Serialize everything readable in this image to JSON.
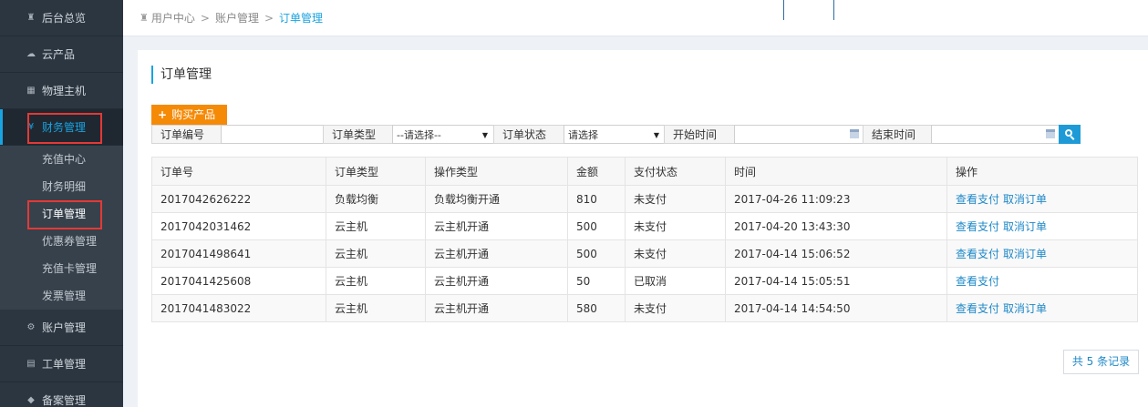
{
  "sidebar": {
    "items": [
      {
        "label": "后台总览",
        "icon": "home-icon"
      },
      {
        "label": "云产品",
        "icon": "cloud-icon"
      },
      {
        "label": "物理主机",
        "icon": "server-icon"
      },
      {
        "label": "财务管理",
        "icon": "finance-icon"
      },
      {
        "label": "账户管理",
        "icon": "users-icon"
      },
      {
        "label": "工单管理",
        "icon": "ticket-icon"
      },
      {
        "label": "备案管理",
        "icon": "shield-icon"
      }
    ],
    "finance_sub": [
      "充值中心",
      "财务明细",
      "订单管理",
      "优惠券管理",
      "充值卡管理",
      "发票管理"
    ],
    "active_color": "#19a3e0",
    "highlight_color": "#e53935"
  },
  "breadcrumb": {
    "items": [
      "用户中心",
      "账户管理",
      "订单管理"
    ],
    "separator": ">"
  },
  "page": {
    "title": "订单管理",
    "buy_button": "购买产品"
  },
  "filters": {
    "order_no_label": "订单编号",
    "order_type_label": "订单类型",
    "order_type_value": "--请选择--",
    "order_status_label": "订单状态",
    "order_status_value": "请选择",
    "start_time_label": "开始时间",
    "end_time_label": "结束时间"
  },
  "table": {
    "headers": [
      "订单号",
      "订单类型",
      "操作类型",
      "金额",
      "支付状态",
      "时间",
      "操作"
    ],
    "rows": [
      {
        "order_no": "2017042626222",
        "type": "负载均衡",
        "op": "负载均衡开通",
        "amount": "810",
        "status": "未支付",
        "time": "2017-04-26 11:09:23",
        "actions": [
          "查看支付",
          "取消订单"
        ]
      },
      {
        "order_no": "2017042031462",
        "type": "云主机",
        "op": "云主机开通",
        "amount": "500",
        "status": "未支付",
        "time": "2017-04-20 13:43:30",
        "actions": [
          "查看支付",
          "取消订单"
        ]
      },
      {
        "order_no": "2017041498641",
        "type": "云主机",
        "op": "云主机开通",
        "amount": "500",
        "status": "未支付",
        "time": "2017-04-14 15:06:52",
        "actions": [
          "查看支付",
          "取消订单"
        ]
      },
      {
        "order_no": "2017041425608",
        "type": "云主机",
        "op": "云主机开通",
        "amount": "50",
        "status": "已取消",
        "time": "2017-04-14 15:05:51",
        "actions": [
          "查看支付"
        ]
      },
      {
        "order_no": "2017041483022",
        "type": "云主机",
        "op": "云主机开通",
        "amount": "580",
        "status": "未支付",
        "time": "2017-04-14 14:54:50",
        "actions": [
          "查看支付",
          "取消订单"
        ]
      }
    ]
  },
  "pager": {
    "text": "共 5 条记录"
  }
}
